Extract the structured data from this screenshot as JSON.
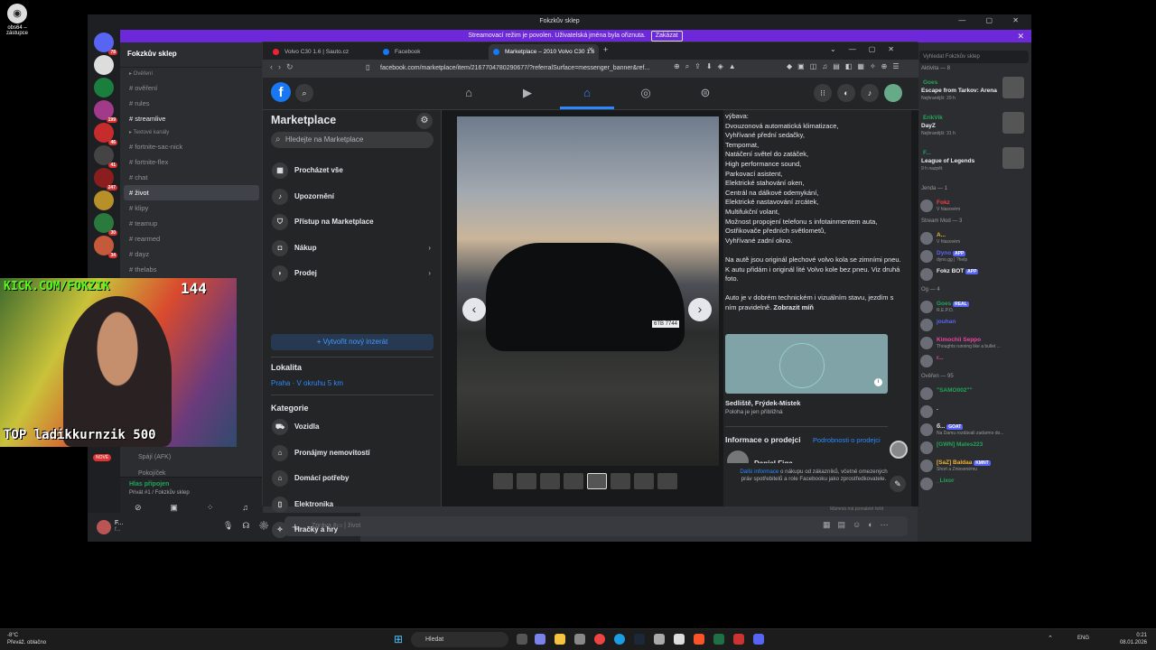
{
  "desktop": {
    "icon_label": "obs64 – zástupce"
  },
  "discord": {
    "window_title": "Fokzkův sklep",
    "banner": {
      "text": "Streamovací režim je povolen. Uživatelská jména byla ořiznuta.",
      "button": "Zakázat"
    },
    "server_badges": [
      "78",
      "199",
      "46",
      "41",
      "247",
      "30",
      "34",
      "72",
      "10"
    ],
    "server_name": "Fokzkův sklep",
    "channels": [
      {
        "label": "Ověření",
        "type": "cat"
      },
      {
        "label": "ověření",
        "type": "ch"
      },
      {
        "label": "rules",
        "type": "ch"
      },
      {
        "label": "streamlive",
        "type": "hi"
      },
      {
        "label": "Textové kanály",
        "type": "cat"
      },
      {
        "label": "fortnite-sac-nick",
        "type": "ch"
      },
      {
        "label": "fortnite-flex",
        "type": "ch"
      },
      {
        "label": "chat",
        "type": "ch"
      },
      {
        "label": "život",
        "type": "sel"
      },
      {
        "label": "klipy",
        "type": "ch"
      },
      {
        "label": "teamup",
        "type": "ch"
      },
      {
        "label": "rearmed",
        "type": "ch"
      },
      {
        "label": "dayz",
        "type": "ch"
      },
      {
        "label": "thelabs",
        "type": "ch"
      }
    ],
    "lower_channels": [
      "Spájí (AFK)",
      "Pokojíček"
    ],
    "new_badge": "NOVÉ",
    "voice": {
      "status": "Hlas připojen",
      "channel": "Privát #1 / Fokzkův sklep"
    },
    "user": {
      "name": "F...",
      "sub": "f..."
    },
    "message_placeholder": "Zpráva #▭ | život",
    "typing": "Mámmá má pomaleté řešit",
    "member_search": "Vyhledat Fokzkův sklep",
    "activity_header": "Aktivita — 8",
    "activities": [
      {
        "name": "Goes",
        "game": "Escape from Tarkov: Arena",
        "time": "Nejhranější: 29 h"
      },
      {
        "name": "ErikVik",
        "game": "DayZ",
        "time": "Nejhranější: 31 h"
      },
      {
        "name": "F...",
        "game": "League of Legends",
        "time": "9 h nazpět"
      }
    ],
    "groups": [
      {
        "header": "Jenda — 1",
        "members": [
          {
            "name": "Fokz",
            "sub": "V hlasovém",
            "color": "#f23f43"
          }
        ]
      },
      {
        "header": "Stream Mod — 3",
        "members": [
          {
            "name": "A...",
            "sub": "V hlasovém",
            "color": "#f0b232"
          },
          {
            "name": "Dyno",
            "sub": "dyno.gg | ?help",
            "tag": "APP",
            "color": "#5865f2"
          },
          {
            "name": "Fokz BOT",
            "sub": "",
            "tag": "APP",
            "color": "#eee"
          }
        ]
      },
      {
        "header": "Og — 4",
        "members": [
          {
            "name": "Goes",
            "sub": "R.E.P.O.",
            "tag": "REAL",
            "color": "#23a559"
          },
          {
            "name": "jouhan",
            "sub": "",
            "color": "#5865f2"
          },
          {
            "name": "Kimochii Seppo",
            "sub": "Thoughts running like a bullet ...",
            "color": "#eb459e"
          },
          {
            "name": "r...",
            "sub": "",
            "color": "#eb459e"
          }
        ]
      },
      {
        "header": "Ověřen — 95",
        "members": [
          {
            "name": "\"SAMO002\"\"",
            "sub": "",
            "color": "#23a559"
          },
          {
            "name": ".",
            "sub": "",
            "color": "#eee"
          },
          {
            "name": "б...",
            "sub": "Na Damu rozdávali zadarmo do...",
            "tag": "GOAT",
            "color": "#eee"
          },
          {
            "name": "[GWN] Mates223",
            "sub": "",
            "color": "#23a559"
          },
          {
            "name": "[SaZ] Baldaa",
            "sub": "Short a Zniesenému",
            "tag": "KMNT",
            "color": "#f0b232"
          },
          {
            "name": "_Lixor",
            "sub": "",
            "color": "#23a559"
          }
        ]
      }
    ]
  },
  "browser": {
    "tabs": [
      {
        "label": "Volvo C30 1.6 | Sauto.cz",
        "active": false,
        "color": "#e23"
      },
      {
        "label": "Facebook",
        "active": false,
        "color": "#1877f2"
      },
      {
        "label": "Marketplace – 2010 Volvo C30 1.6",
        "active": true,
        "color": "#1877f2"
      }
    ],
    "url": "facebook.com/marketplace/item/2167704780290677/?referralSurface=messenger_banner&ref...",
    "marketplace": {
      "title": "Marketplace",
      "search_placeholder": "Hledejte na Marketplace",
      "menu": [
        "Procházet vše",
        "Upozornění",
        "Přístup na Marketplace",
        "Nákup",
        "Prodej"
      ],
      "new_listing": "+ Vytvořit nový inzerát",
      "location_header": "Lokalita",
      "location": "Praha · V okruhu 5 km",
      "categories_header": "Kategorie",
      "categories": [
        "Vozidla",
        "Pronájmy nemovitostí",
        "Domácí potřeby",
        "Elektronika",
        "Hračky a hry"
      ]
    },
    "listing": {
      "plate": "6TB 7744",
      "description": "výbava:\nDvouzonová automatická klimatizace,\nVyhřívané přední sedačky,\nTempomat,\nNatáčení světel do zatáček,\nHigh performance sound,\nParkovací asistent,\nElektrické stahování oken,\nCentrál na dálkové odemykání,\nElektrické nastavování zrcátek,\nMultifukční volant,\nMožnost propojení telefonu s infotainmentem auta,\nOstřikovače předních světlometů,\nVyhřívané zadní okno.\n\nNa autě jsou originál plechové volvo kola se zimními pneu. K autu přidám i originál lité Volvo kole bez pneu. Viz druhá foto.\n\nAuto je v dobrém technickém i vizuálním stavu, jezdím s ním pravidelně.",
      "show_more": "Zobrazit míň",
      "location": "Sedliště, Frýdek-Místek",
      "location_note": "Poloha je jen přibližná",
      "seller_info": "Informace o prodejci",
      "seller_link": "Podrobnosti o prodejci",
      "seller_name": "Daniel Figa",
      "popup_link": "Další informace",
      "popup_text": " o nákupu od zákazníků, včetně omezených práv spotřebitelů a role Facebooku jako zprostředkovatele."
    }
  },
  "stream": {
    "url": "KICK.COM/FOKZIK",
    "count": "144",
    "top": "TOP ladikkurnzik 500"
  },
  "taskbar": {
    "weather_temp": "-8°C",
    "weather_text": "Převáž. oblačno",
    "search": "Hledat",
    "lang": "ENG",
    "time": "0:21",
    "date": "08.01.2026"
  }
}
